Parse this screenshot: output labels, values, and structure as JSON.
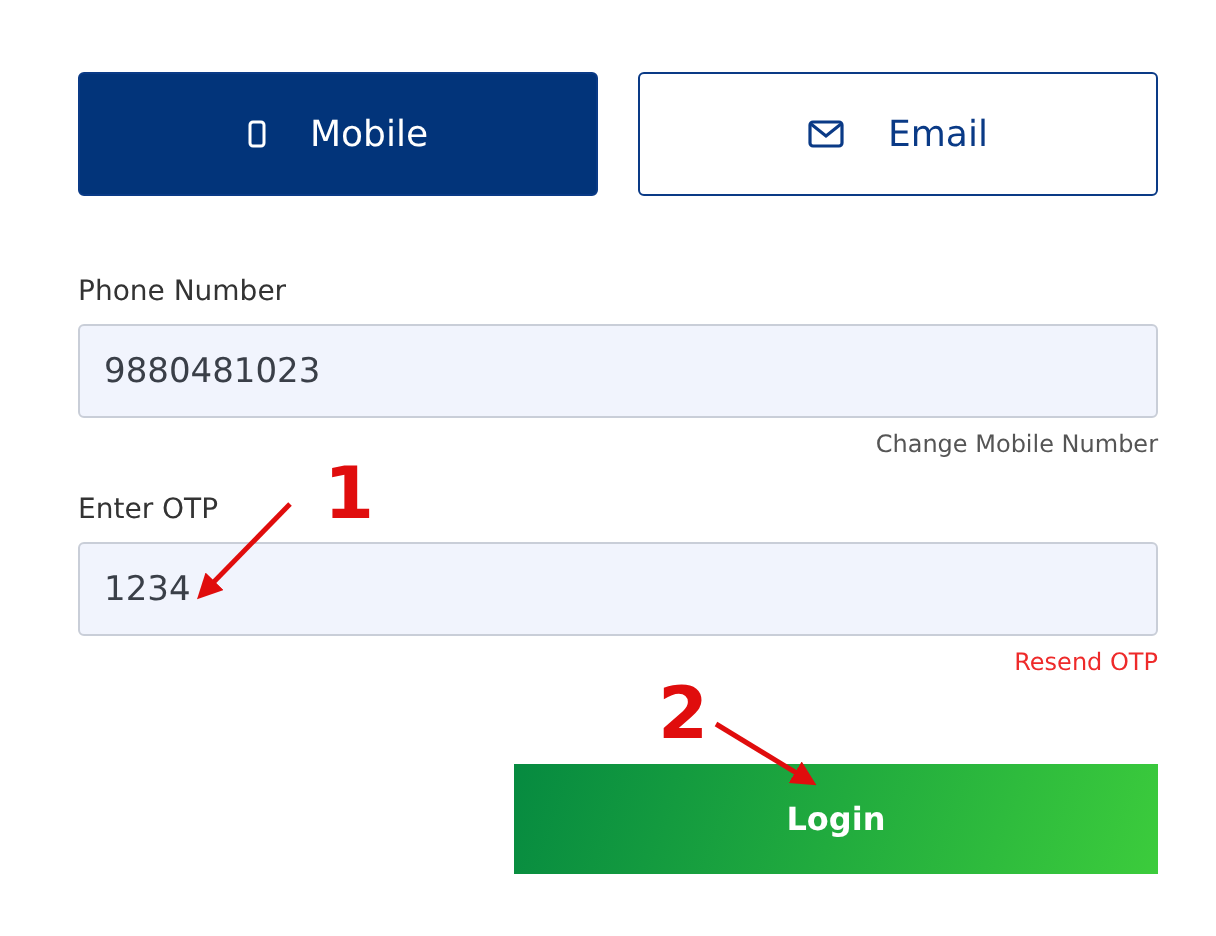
{
  "tabs": [
    {
      "label": "Mobile",
      "kind": "phone",
      "selected": true
    },
    {
      "label": "Email",
      "kind": "mail",
      "selected": false
    }
  ],
  "fields": [
    {
      "label": "Phone Number",
      "value": "9880481023",
      "link": "Change Mobile Number",
      "kind": "change"
    },
    {
      "label": "Enter OTP",
      "value": "1234",
      "link": "Resend OTP",
      "kind": "resend"
    }
  ],
  "login_button": "Login",
  "annotations": [
    {
      "number": "1",
      "kind": "otp"
    },
    {
      "number": "2",
      "kind": "login"
    }
  ]
}
